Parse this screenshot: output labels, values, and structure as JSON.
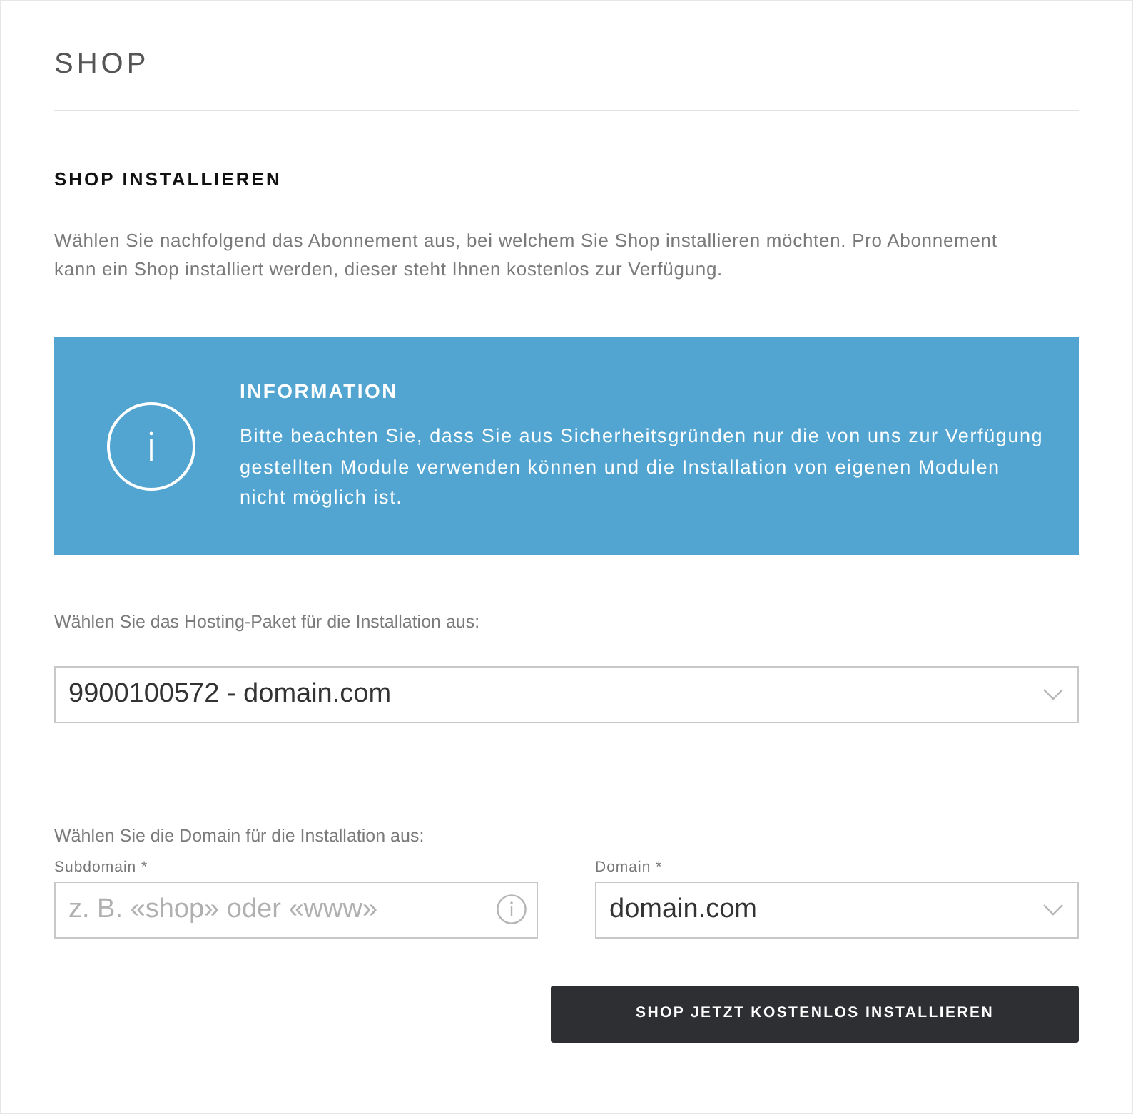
{
  "page": {
    "title": "SHOP"
  },
  "section": {
    "heading": "SHOP INSTALLIEREN",
    "intro": "Wählen Sie nachfolgend das Abonnement aus, bei welchem Sie Shop installieren möchten. Pro Abonnement kann ein Shop installiert werden, dieser steht Ihnen kostenlos zur Verfügung."
  },
  "info_box": {
    "heading": "INFORMATION",
    "text": "Bitte beachten Sie, dass Sie aus Sicherheitsgründen nur die von uns zur Verfügung gestellten Module verwenden können und die Installation von eigenen Modulen nicht möglich ist."
  },
  "hosting": {
    "label": "Wählen Sie das Hosting-Paket für die Installation aus:",
    "select": {
      "value": "9900100572 - domain.com"
    }
  },
  "domain_section": {
    "label": "Wählen Sie die Domain für die Installation aus:",
    "fields": [
      {
        "kind": "input",
        "label": "Subdomain *",
        "placeholder": "z. B. «shop» oder «www»"
      },
      {
        "kind": "select",
        "label": "Domain *",
        "value": "domain.com"
      }
    ]
  },
  "submit_button": {
    "label": "SHOP JETZT KOSTENLOS INSTALLIEREN"
  }
}
